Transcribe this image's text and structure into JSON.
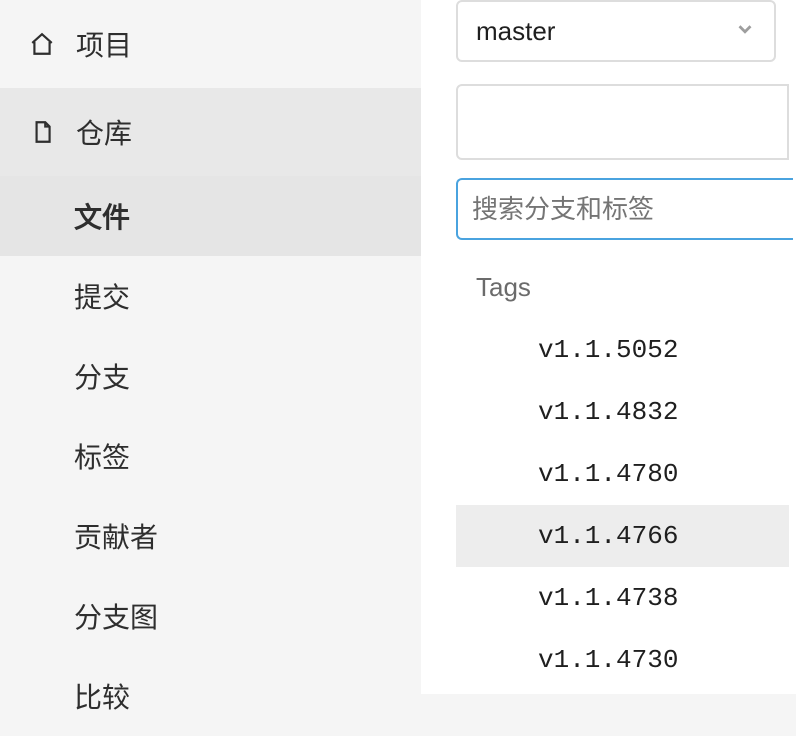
{
  "sidebar": {
    "project_label": "项目",
    "repo_label": "仓库",
    "items": [
      {
        "label": "文件",
        "active": true
      },
      {
        "label": "提交",
        "active": false
      },
      {
        "label": "分支",
        "active": false
      },
      {
        "label": "标签",
        "active": false
      },
      {
        "label": "贡献者",
        "active": false
      },
      {
        "label": "分支图",
        "active": false
      },
      {
        "label": "比较",
        "active": false
      }
    ]
  },
  "branch_selector": {
    "selected": "master"
  },
  "search": {
    "placeholder": "搜索分支和标签"
  },
  "tags_section": {
    "label": "Tags",
    "items": [
      {
        "label": "v1.1.5052",
        "hover": false
      },
      {
        "label": "v1.1.4832",
        "hover": false
      },
      {
        "label": "v1.1.4780",
        "hover": false
      },
      {
        "label": "v1.1.4766",
        "hover": true
      },
      {
        "label": "v1.1.4738",
        "hover": false
      },
      {
        "label": "v1.1.4730",
        "hover": false
      }
    ]
  }
}
